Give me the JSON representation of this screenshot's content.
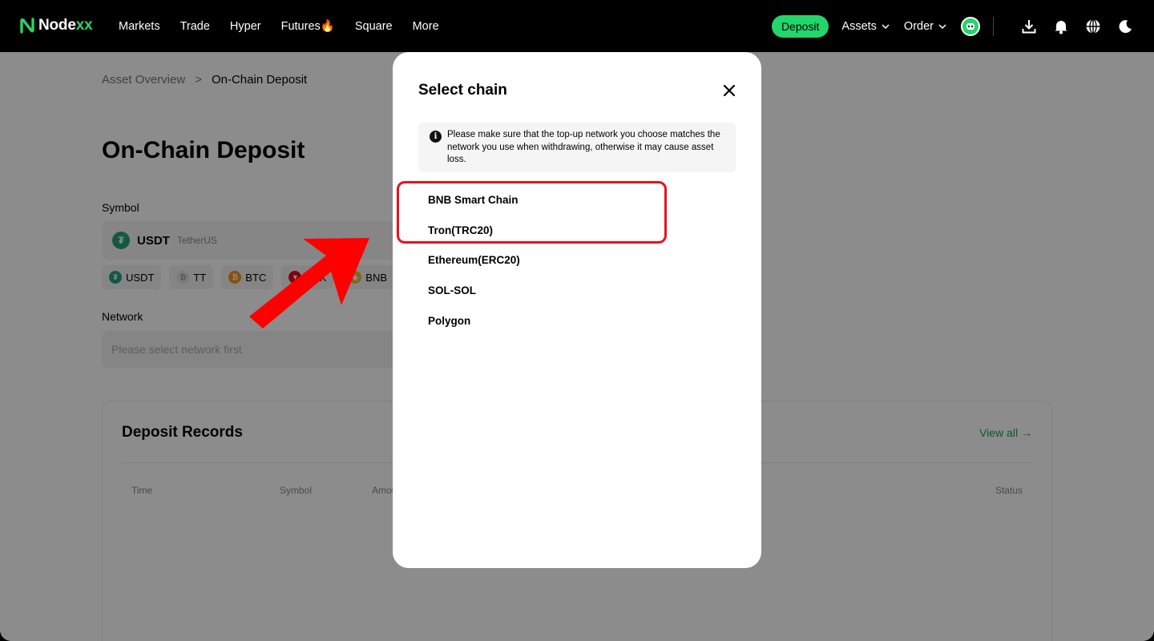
{
  "nav": {
    "logo_main": "Node",
    "logo_accent": "xx",
    "links": [
      {
        "label": "Markets"
      },
      {
        "label": "Trade"
      },
      {
        "label": "Hyper"
      },
      {
        "label": "Futures🔥"
      },
      {
        "label": "Square"
      },
      {
        "label": "More"
      }
    ],
    "deposit_label": "Deposit",
    "assets_label": "Assets",
    "order_label": "Order"
  },
  "breadcrumb": {
    "parent": "Asset Overview",
    "separator": ">",
    "current": "On-Chain Deposit"
  },
  "page": {
    "title": "On-Chain Deposit",
    "symbol_label": "Symbol",
    "selected_symbol": "USDT",
    "selected_symbol_name": "TetherUS",
    "quick_symbols": [
      "USDT",
      "TT",
      "BTC",
      "TRX",
      "BNB"
    ],
    "network_label": "Network",
    "network_placeholder": "Please select network first"
  },
  "records": {
    "title": "Deposit Records",
    "view_all": "View all →",
    "columns": [
      "Time",
      "Symbol",
      "Amount",
      "Status"
    ]
  },
  "modal": {
    "title": "Select chain",
    "notice": "Please make sure that the top-up network you choose matches the network you use when withdrawing, otherwise it may cause asset loss.",
    "chains": [
      "BNB Smart Chain",
      "Tron(TRC20)",
      "Ethereum(ERC20)",
      "SOL-SOL",
      "Polygon"
    ]
  },
  "colors": {
    "accent": "#22d66b",
    "annotation": "#e8121d"
  }
}
